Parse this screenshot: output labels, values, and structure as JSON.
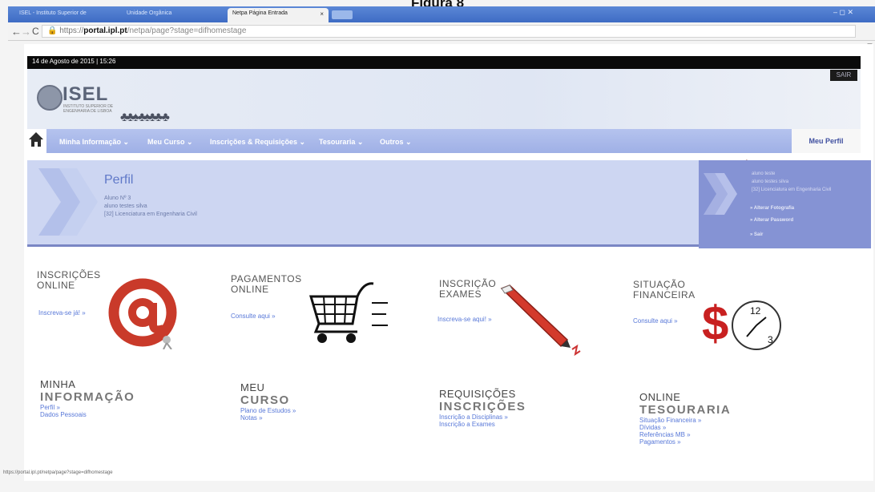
{
  "figure": {
    "title": "Figura 8"
  },
  "browser": {
    "tabs": [
      {
        "label": "ISEL - Instituto Superior de"
      },
      {
        "label": "Unidade Orgânica"
      },
      {
        "label": "Netpa Página Entrada"
      }
    ],
    "active_tab_close": "×",
    "url_protocol": "https://",
    "url_host": "portal.ipl.pt",
    "url_path": "/netpa/page?stage=difhomestage",
    "window_controls": "–  ◻  ✕",
    "status_url": "https://portal.ipl.pt/netpa/page?stage=difhomestage"
  },
  "page": {
    "datetime": "14 de Agosto de 2015 | 15:26",
    "exit_label": "SAIR",
    "logo": {
      "name": "ISEL",
      "subtitle": "INSTITUTO SUPERIOR DE ENGENHARIA DE LISBOA"
    },
    "nav": {
      "items": [
        {
          "label": "Minha Informação ⌄"
        },
        {
          "label": "Meu Curso ⌄"
        },
        {
          "label": "Inscrições & Requisições ⌄"
        },
        {
          "label": "Tesouraria ⌄"
        },
        {
          "label": "Outros ⌄"
        }
      ],
      "profile_label": "Meu Perfil"
    },
    "profile": {
      "title": "Perfil",
      "lines": [
        "Aluno Nº 3",
        "aluno testes silva",
        "[32] Licenciatura em Engenharia Civil"
      ]
    },
    "dropdown": {
      "lines": [
        "aluno teste",
        "aluno testes silva",
        "[32] Licenciatura em Engenharia Civil"
      ],
      "items": [
        "Alterar Fotografia",
        "Alterar Password",
        "Sair"
      ]
    },
    "tiles": [
      {
        "title1": "INSCRIÇÕES",
        "title2": "ONLINE",
        "link": "Inscreva-se já! »"
      },
      {
        "title1": "PAGAMENTOS",
        "title2": "ONLINE",
        "link": "Consulte aqui »"
      },
      {
        "title1": "INSCRIÇÃO",
        "title2": "EXAMES",
        "link": "Inscreva-se aqui! »"
      },
      {
        "title1": "SITUAÇÃO",
        "title2": "FINANCEIRA",
        "link": "Consulte aqui »"
      }
    ],
    "sections": [
      {
        "title1": "MINHA",
        "title2": "INFORMAÇÃO",
        "links": [
          "Perfil »",
          "Dados Pessoais"
        ]
      },
      {
        "title1": "MEU",
        "title2": "CURSO",
        "links": [
          "Plano de Estudos »",
          "Notas »"
        ]
      },
      {
        "title1": "REQUISIÇÕES",
        "title2": "INSCRIÇÕES",
        "links": [
          "Inscrição a Disciplinas »",
          "Inscrição a Exames"
        ]
      },
      {
        "title1": "ONLINE",
        "title2": "TESOURARIA",
        "links": [
          "Situação Financeira »",
          "Dívidas »",
          "Referências MB »",
          "Pagamentos »"
        ]
      }
    ]
  },
  "colors": {
    "nav_bg": "#a9b8eb",
    "profile_bg": "#cdd6f2",
    "dropdown_bg": "#8593d4",
    "link": "#5878d8",
    "arrow_red": "#d8232a"
  },
  "icons": [
    "home-icon",
    "at-sign-icon",
    "shopping-cart-icon",
    "pen-icon",
    "dollar-clock-icon",
    "chevron-arrow-icon"
  ]
}
